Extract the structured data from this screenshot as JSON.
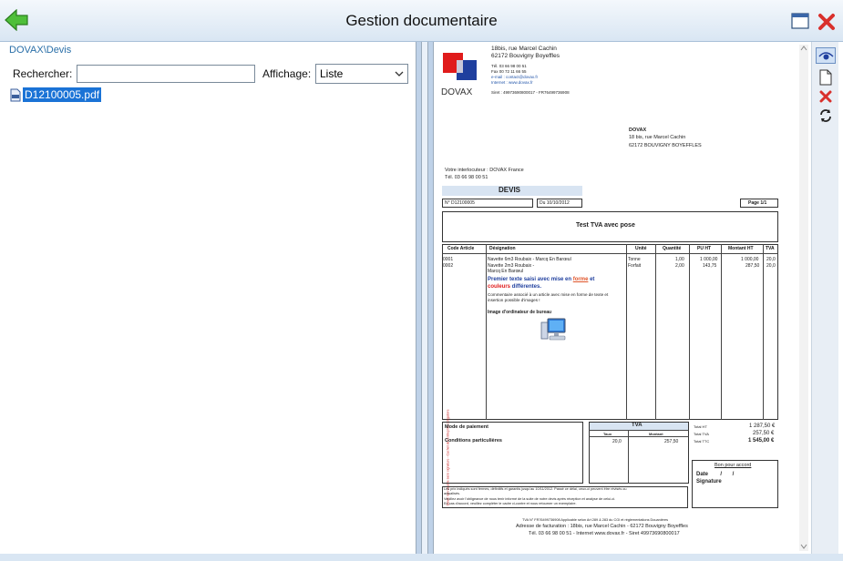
{
  "window": {
    "title": "Gestion documentaire"
  },
  "left": {
    "breadcrumb": "DOVAX\\Devis",
    "search_label": "Rechercher:",
    "search_value": "",
    "view_label": "Affichage:",
    "view_value": "Liste",
    "files": [
      {
        "name": "D12100005.pdf"
      }
    ]
  },
  "doc": {
    "company": {
      "logo_text": "DOVAX",
      "address1": "18bis, rue Marcel Cachin",
      "address2": "62172 Bouvigny Boyeffles",
      "tel": "Tél. 03 66 98 00 51",
      "fax": "Fax 00 72 11 66 55",
      "email": "e-mail : contact@dovax.fr",
      "internet": "Internet : www.dovax.fr",
      "siret": "Siret : 49973690800017 - FR76499736908"
    },
    "recipient": {
      "name": "DOVAX",
      "address1": "18 bis, rue Marcel Cachin",
      "address2": "62172 BOUVIGNY BOYEFFLES"
    },
    "contact": {
      "line1": "Votre interlocuteur : DOVAX France",
      "line2": "Tél. 03 66 98 00 51"
    },
    "heading": "DEVIS",
    "number": "N° D12100005",
    "date": "Du 10/10/2012",
    "page": "Page 1/1",
    "subject": "Test TVA avec pose",
    "columns": [
      "Code Article",
      "Désignation",
      "Unité",
      "Quantité",
      "PU HT",
      "Montant HT",
      "TVA"
    ],
    "rows": [
      {
        "code": "0001",
        "designation": "Navette 6m3 Roubaix - Marcq En Barœul",
        "unit": "Tonne",
        "qty": "1,00",
        "pu": "1 000,00",
        "amount": "1 000,00",
        "tva": "20,0"
      },
      {
        "code": "0002",
        "designation": "Navette 2m3 Roubaix -",
        "unit": "Forfait",
        "qty": "2,00",
        "pu": "143,75",
        "amount": "287,50",
        "tva": "20,0"
      }
    ],
    "row2_line2": "Marcq En Barœul",
    "rich_text": {
      "part1": "Premier texte saisi avec mise en ",
      "forme": "forme",
      "part2": " et",
      "couleurs": "couleurs",
      "differentes": " différentes."
    },
    "comment": "Commentaire associé à un article avec mise en forme de texte et insertion possible d'images !",
    "image_caption": "Image d'ordinateur de bureau",
    "payment": "Mode de paiement",
    "conditions": "Conditions particulières",
    "side_label": "Devis non valable sans signature - Cachet de l'entreprise obligatoire",
    "tva_table": {
      "title": "TVA",
      "col1": "Taux",
      "col2": "Montant",
      "rate": "20,0",
      "amount": "257,50"
    },
    "totals": [
      {
        "label": "Total HT",
        "value": "1 287,50 €"
      },
      {
        "label": "Total TVA",
        "value": "257,50 €"
      },
      {
        "label": "Total TTC",
        "value": "1 545,00 €"
      }
    ],
    "agreement": {
      "title": "Bon pour accord",
      "date": "Date        /       /",
      "signature": "Signature"
    },
    "notes": [
      "Les prix indiqués sont fermes, définitifs et garantis jusqu'au 10/11/2012. Passé ce délai, ceux-ci peuvent être révisés ou",
      "actualisés.",
      "Veuillez avoir l'obligeance de nous tenir informé de la suite de notre devis après réception et analyse de celui-ci.",
      "En cas d'accord, veuillez compléter le cadre ci-contre et nous retourner un exemplaire."
    ],
    "footer": [
      "TVA N° FR76499736908 Applicable selon Art 289 & 283 du CGI et réglementations Douanières",
      "Adresse de facturation : 18bis, rue Marcel Cachin - 62172 Bouvigny Boyeffles",
      "Tél. 03 66 98 00 51 - Internet www.dovax.fr - Siret 49973690800017"
    ]
  },
  "colors": {
    "accent": "#1a73d6",
    "title_bg": "#d9e6f3",
    "close": "#d9302c",
    "back": "#3ea52e"
  },
  "icons": [
    "back-arrow-icon",
    "maximize-icon",
    "close-icon",
    "pdf-file-icon",
    "eye-icon",
    "new-page-icon",
    "delete-icon",
    "refresh-icon"
  ]
}
